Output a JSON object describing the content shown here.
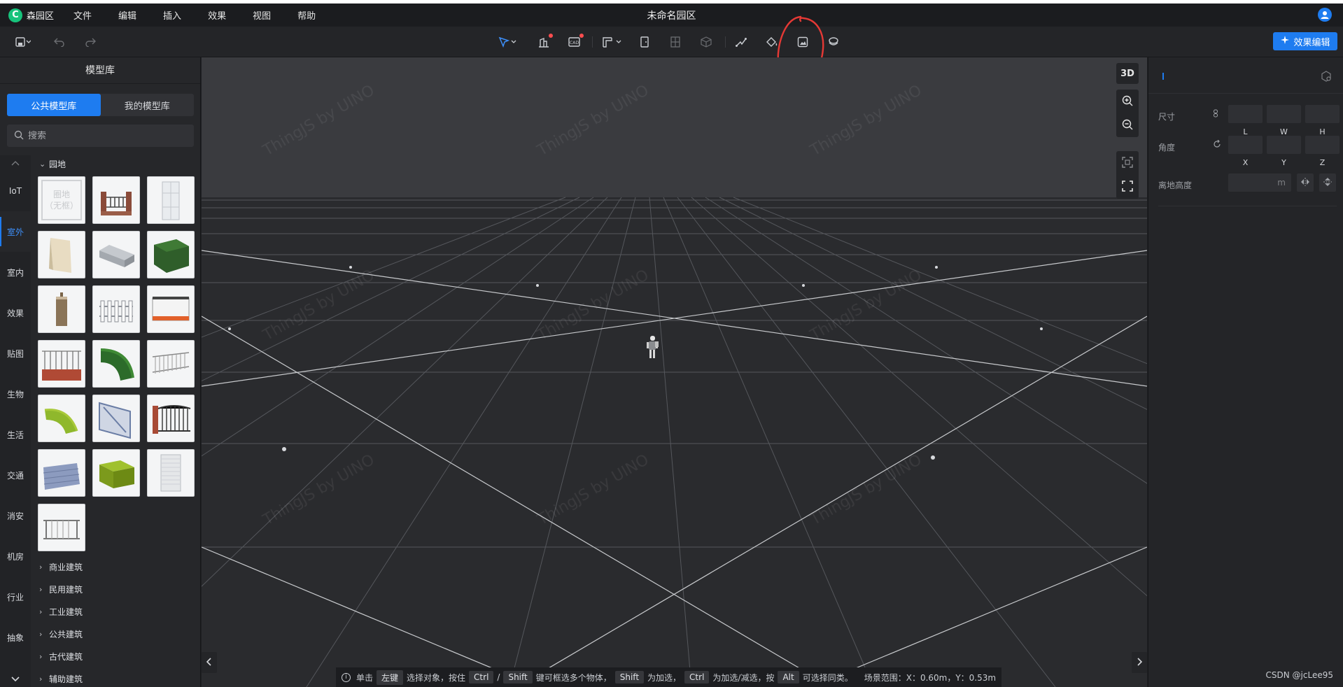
{
  "app": {
    "name": "森园区",
    "title": "未命名园区",
    "menu": [
      "文件",
      "编辑",
      "插入",
      "效果",
      "视图",
      "帮助"
    ]
  },
  "toolbar": {
    "effect_edit_label": "效果编辑",
    "tools": [
      "save-icon",
      "undo-icon",
      "redo-icon",
      "select-pointer-icon",
      "building-icon",
      "cad-icon",
      "wall-icon",
      "door-icon",
      "window-icon",
      "box-icon",
      "path-icon",
      "fill-icon",
      "image-icon",
      "layers-icon"
    ]
  },
  "left_panel": {
    "title": "模型库",
    "tabs": [
      {
        "label": "公共模型库",
        "active": true
      },
      {
        "label": "我的模型库",
        "active": false
      }
    ],
    "search_placeholder": "搜索",
    "categories": [
      "IoT",
      "室外",
      "室内",
      "效果",
      "贴图",
      "生物",
      "生活",
      "交通",
      "消安",
      "机房",
      "行业",
      "抽象"
    ],
    "active_category": "室外",
    "open_group": "园地",
    "first_thumb_text": [
      "圈地",
      "（无框）"
    ],
    "collapsed_groups": [
      "商业建筑",
      "民用建筑",
      "工业建筑",
      "公共建筑",
      "古代建筑",
      "辅助建筑"
    ]
  },
  "viewport": {
    "view_mode": "3D",
    "watermark": "ThingJS by UINO"
  },
  "hint": {
    "p1": "单击",
    "k_left": "左键",
    "p2": "选择对象，按住",
    "k_ctrl": "Ctrl",
    "slash": "/",
    "k_shift": "Shift",
    "p3": "键可框选多个物体，",
    "k_shift2": "Shift",
    "p4": "为加选，",
    "k_ctrl2": "Ctrl",
    "p5": "为加选/减选，按",
    "k_alt": "Alt",
    "p6": "可选择同类。",
    "range": "场景范围：X：0.60m，Y：0.53m"
  },
  "right_panel": {
    "size_label": "尺寸",
    "angle_label": "角度",
    "height_label": "离地高度",
    "height_unit": "m",
    "size_axes": [
      "L",
      "W",
      "H"
    ],
    "angle_axes": [
      "X",
      "Y",
      "Z"
    ]
  },
  "credit": "CSDN @jcLee95",
  "colors": {
    "accent": "#1e7cf0",
    "annotation": "#e53935"
  }
}
